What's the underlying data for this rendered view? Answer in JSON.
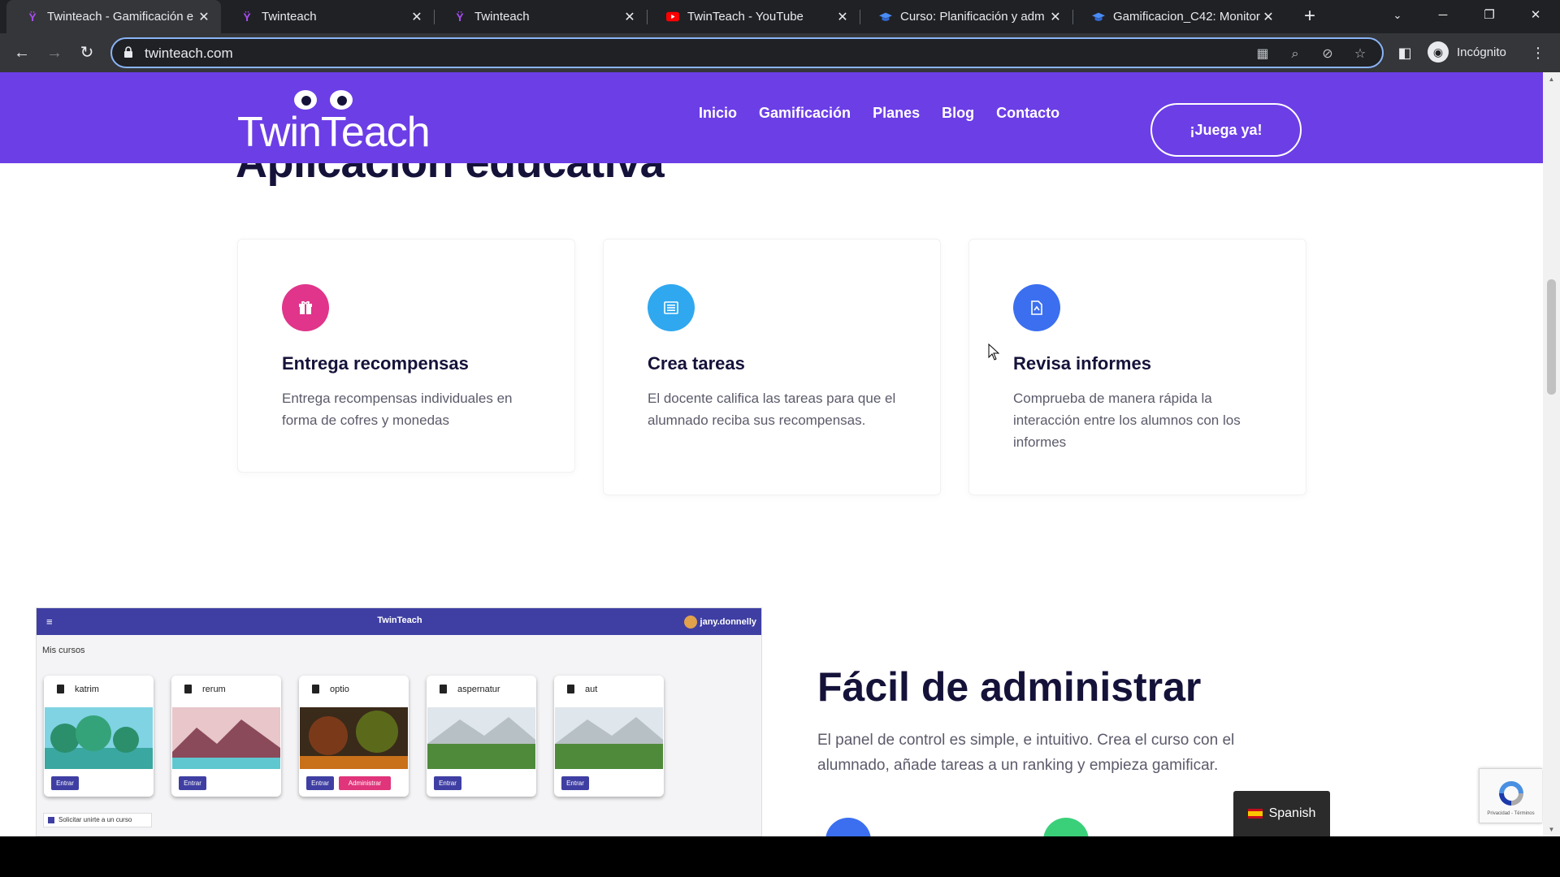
{
  "browser": {
    "tabs": [
      {
        "title": "Twinteach - Gamificación e",
        "icon": "twinteach-favicon",
        "active": true
      },
      {
        "title": "Twinteach",
        "icon": "twinteach-favicon",
        "active": false
      },
      {
        "title": "Twinteach",
        "icon": "twinteach-favicon",
        "active": false
      },
      {
        "title": "TwinTeach - YouTube",
        "icon": "youtube-favicon",
        "active": false
      },
      {
        "title": "Curso: Planificación y adm",
        "icon": "mortarboard-favicon",
        "active": false
      },
      {
        "title": "Gamificacion_C42: Monitor",
        "icon": "mortarboard-favicon",
        "active": false
      }
    ],
    "url": "twinteach.com",
    "profile_label": "Incógnito",
    "colors": {
      "frame": "#202124",
      "toolbar": "#35363a",
      "focus_ring": "#8ab4f8"
    }
  },
  "site": {
    "logo_text": "TwinTeach",
    "nav": [
      "Inicio",
      "Gamificación",
      "Planes",
      "Blog",
      "Contacto"
    ],
    "cta": "¡Juega ya!",
    "colors": {
      "header": "#6c3ee6",
      "heading": "#15123a",
      "body_text": "#5b5b6b"
    }
  },
  "section1": {
    "heading": "Aplicación educativa",
    "cards": [
      {
        "icon": "gift-icon",
        "color": "#e0358b",
        "title": "Entrega recompensas",
        "text": "Entrega recompensas individuales en forma de cofres y monedas"
      },
      {
        "icon": "list-icon",
        "color": "#2fa8f0",
        "title": "Crea tareas",
        "text": "El docente califica las tareas para que el alumnado reciba sus recompensas."
      },
      {
        "icon": "report-icon",
        "color": "#3b6ff0",
        "title": "Revisa informes",
        "text": "Comprueba de manera rápida la interacción entre los alumnos con los informes"
      }
    ]
  },
  "preview": {
    "app_title": "TwinTeach",
    "user": "jany.donnelly",
    "subtitle": "Mis cursos",
    "courses": [
      {
        "name": "katrim",
        "buttons": [
          "Entrar"
        ]
      },
      {
        "name": "rerum",
        "buttons": [
          "Entrar"
        ]
      },
      {
        "name": "optio",
        "buttons": [
          "Entrar",
          "Administrar"
        ]
      },
      {
        "name": "aspernatur",
        "buttons": [
          "Entrar"
        ]
      },
      {
        "name": "aut",
        "buttons": [
          "Entrar"
        ]
      }
    ],
    "join_label": "Solicitar unirte a un curso"
  },
  "section2": {
    "heading": "Fácil de administrar",
    "lead": "El panel de control es simple, e intuitivo. Crea el curso con el alumnado, añade tareas a un ranking y empieza gamificar."
  },
  "language_widget": {
    "label": "Spanish"
  },
  "recaptcha": {
    "terms": "Privacidad - Términos"
  }
}
